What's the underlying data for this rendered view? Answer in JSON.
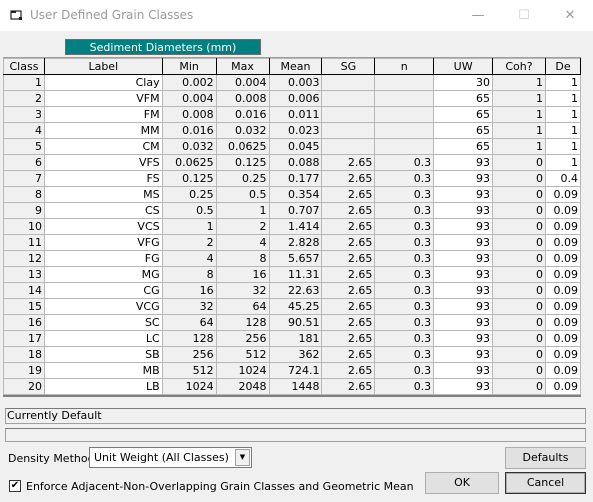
{
  "window": {
    "title": "User Defined Grain Classes",
    "controls": {
      "minimize": "—",
      "maximize": "☐",
      "close": "✕"
    }
  },
  "grid": {
    "band_header": "Sediment Diameters (mm)",
    "columns": [
      "Class",
      "Label",
      "Min",
      "Max",
      "Mean",
      "SG",
      "n",
      "UW",
      "Coh?",
      "De"
    ],
    "rows": [
      {
        "class": "1",
        "label": "Clay",
        "min": "0.002",
        "max": "0.004",
        "mean": "0.003",
        "sg": "",
        "n": "",
        "uw": "30",
        "coh": "1",
        "de": "1"
      },
      {
        "class": "2",
        "label": "VFM",
        "min": "0.004",
        "max": "0.008",
        "mean": "0.006",
        "sg": "",
        "n": "",
        "uw": "65",
        "coh": "1",
        "de": "1"
      },
      {
        "class": "3",
        "label": "FM",
        "min": "0.008",
        "max": "0.016",
        "mean": "0.011",
        "sg": "",
        "n": "",
        "uw": "65",
        "coh": "1",
        "de": "1"
      },
      {
        "class": "4",
        "label": "MM",
        "min": "0.016",
        "max": "0.032",
        "mean": "0.023",
        "sg": "",
        "n": "",
        "uw": "65",
        "coh": "1",
        "de": "1"
      },
      {
        "class": "5",
        "label": "CM",
        "min": "0.032",
        "max": "0.0625",
        "mean": "0.045",
        "sg": "",
        "n": "",
        "uw": "65",
        "coh": "1",
        "de": "1"
      },
      {
        "class": "6",
        "label": "VFS",
        "min": "0.0625",
        "max": "0.125",
        "mean": "0.088",
        "sg": "2.65",
        "n": "0.3",
        "uw": "93",
        "coh": "0",
        "de": "1"
      },
      {
        "class": "7",
        "label": "FS",
        "min": "0.125",
        "max": "0.25",
        "mean": "0.177",
        "sg": "2.65",
        "n": "0.3",
        "uw": "93",
        "coh": "0",
        "de": "0.4"
      },
      {
        "class": "8",
        "label": "MS",
        "min": "0.25",
        "max": "0.5",
        "mean": "0.354",
        "sg": "2.65",
        "n": "0.3",
        "uw": "93",
        "coh": "0",
        "de": "0.09"
      },
      {
        "class": "9",
        "label": "CS",
        "min": "0.5",
        "max": "1",
        "mean": "0.707",
        "sg": "2.65",
        "n": "0.3",
        "uw": "93",
        "coh": "0",
        "de": "0.09"
      },
      {
        "class": "10",
        "label": "VCS",
        "min": "1",
        "max": "2",
        "mean": "1.414",
        "sg": "2.65",
        "n": "0.3",
        "uw": "93",
        "coh": "0",
        "de": "0.09"
      },
      {
        "class": "11",
        "label": "VFG",
        "min": "2",
        "max": "4",
        "mean": "2.828",
        "sg": "2.65",
        "n": "0.3",
        "uw": "93",
        "coh": "0",
        "de": "0.09"
      },
      {
        "class": "12",
        "label": "FG",
        "min": "4",
        "max": "8",
        "mean": "5.657",
        "sg": "2.65",
        "n": "0.3",
        "uw": "93",
        "coh": "0",
        "de": "0.09"
      },
      {
        "class": "13",
        "label": "MG",
        "min": "8",
        "max": "16",
        "mean": "11.31",
        "sg": "2.65",
        "n": "0.3",
        "uw": "93",
        "coh": "0",
        "de": "0.09"
      },
      {
        "class": "14",
        "label": "CG",
        "min": "16",
        "max": "32",
        "mean": "22.63",
        "sg": "2.65",
        "n": "0.3",
        "uw": "93",
        "coh": "0",
        "de": "0.09"
      },
      {
        "class": "15",
        "label": "VCG",
        "min": "32",
        "max": "64",
        "mean": "45.25",
        "sg": "2.65",
        "n": "0.3",
        "uw": "93",
        "coh": "0",
        "de": "0.09"
      },
      {
        "class": "16",
        "label": "SC",
        "min": "64",
        "max": "128",
        "mean": "90.51",
        "sg": "2.65",
        "n": "0.3",
        "uw": "93",
        "coh": "0",
        "de": "0.09"
      },
      {
        "class": "17",
        "label": "LC",
        "min": "128",
        "max": "256",
        "mean": "181",
        "sg": "2.65",
        "n": "0.3",
        "uw": "93",
        "coh": "0",
        "de": "0.09"
      },
      {
        "class": "18",
        "label": "SB",
        "min": "256",
        "max": "512",
        "mean": "362",
        "sg": "2.65",
        "n": "0.3",
        "uw": "93",
        "coh": "0",
        "de": "0.09"
      },
      {
        "class": "19",
        "label": "MB",
        "min": "512",
        "max": "1024",
        "mean": "724.1",
        "sg": "2.65",
        "n": "0.3",
        "uw": "93",
        "coh": "0",
        "de": "0.09"
      },
      {
        "class": "20",
        "label": "LB",
        "min": "1024",
        "max": "2048",
        "mean": "1448",
        "sg": "2.65",
        "n": "0.3",
        "uw": "93",
        "coh": "0",
        "de": "0.09"
      }
    ]
  },
  "status": {
    "line1": "Currently Default",
    "line2": ""
  },
  "density": {
    "label": "Density Method",
    "selected": "Unit Weight (All Classes)"
  },
  "enforce": {
    "label": "Enforce Adjacent-Non-Overlapping Grain Classes and Geometric Mean",
    "checked": true,
    "check_glyph": "✔"
  },
  "buttons": {
    "defaults": "Defaults",
    "ok": "OK",
    "cancel": "Cancel"
  }
}
